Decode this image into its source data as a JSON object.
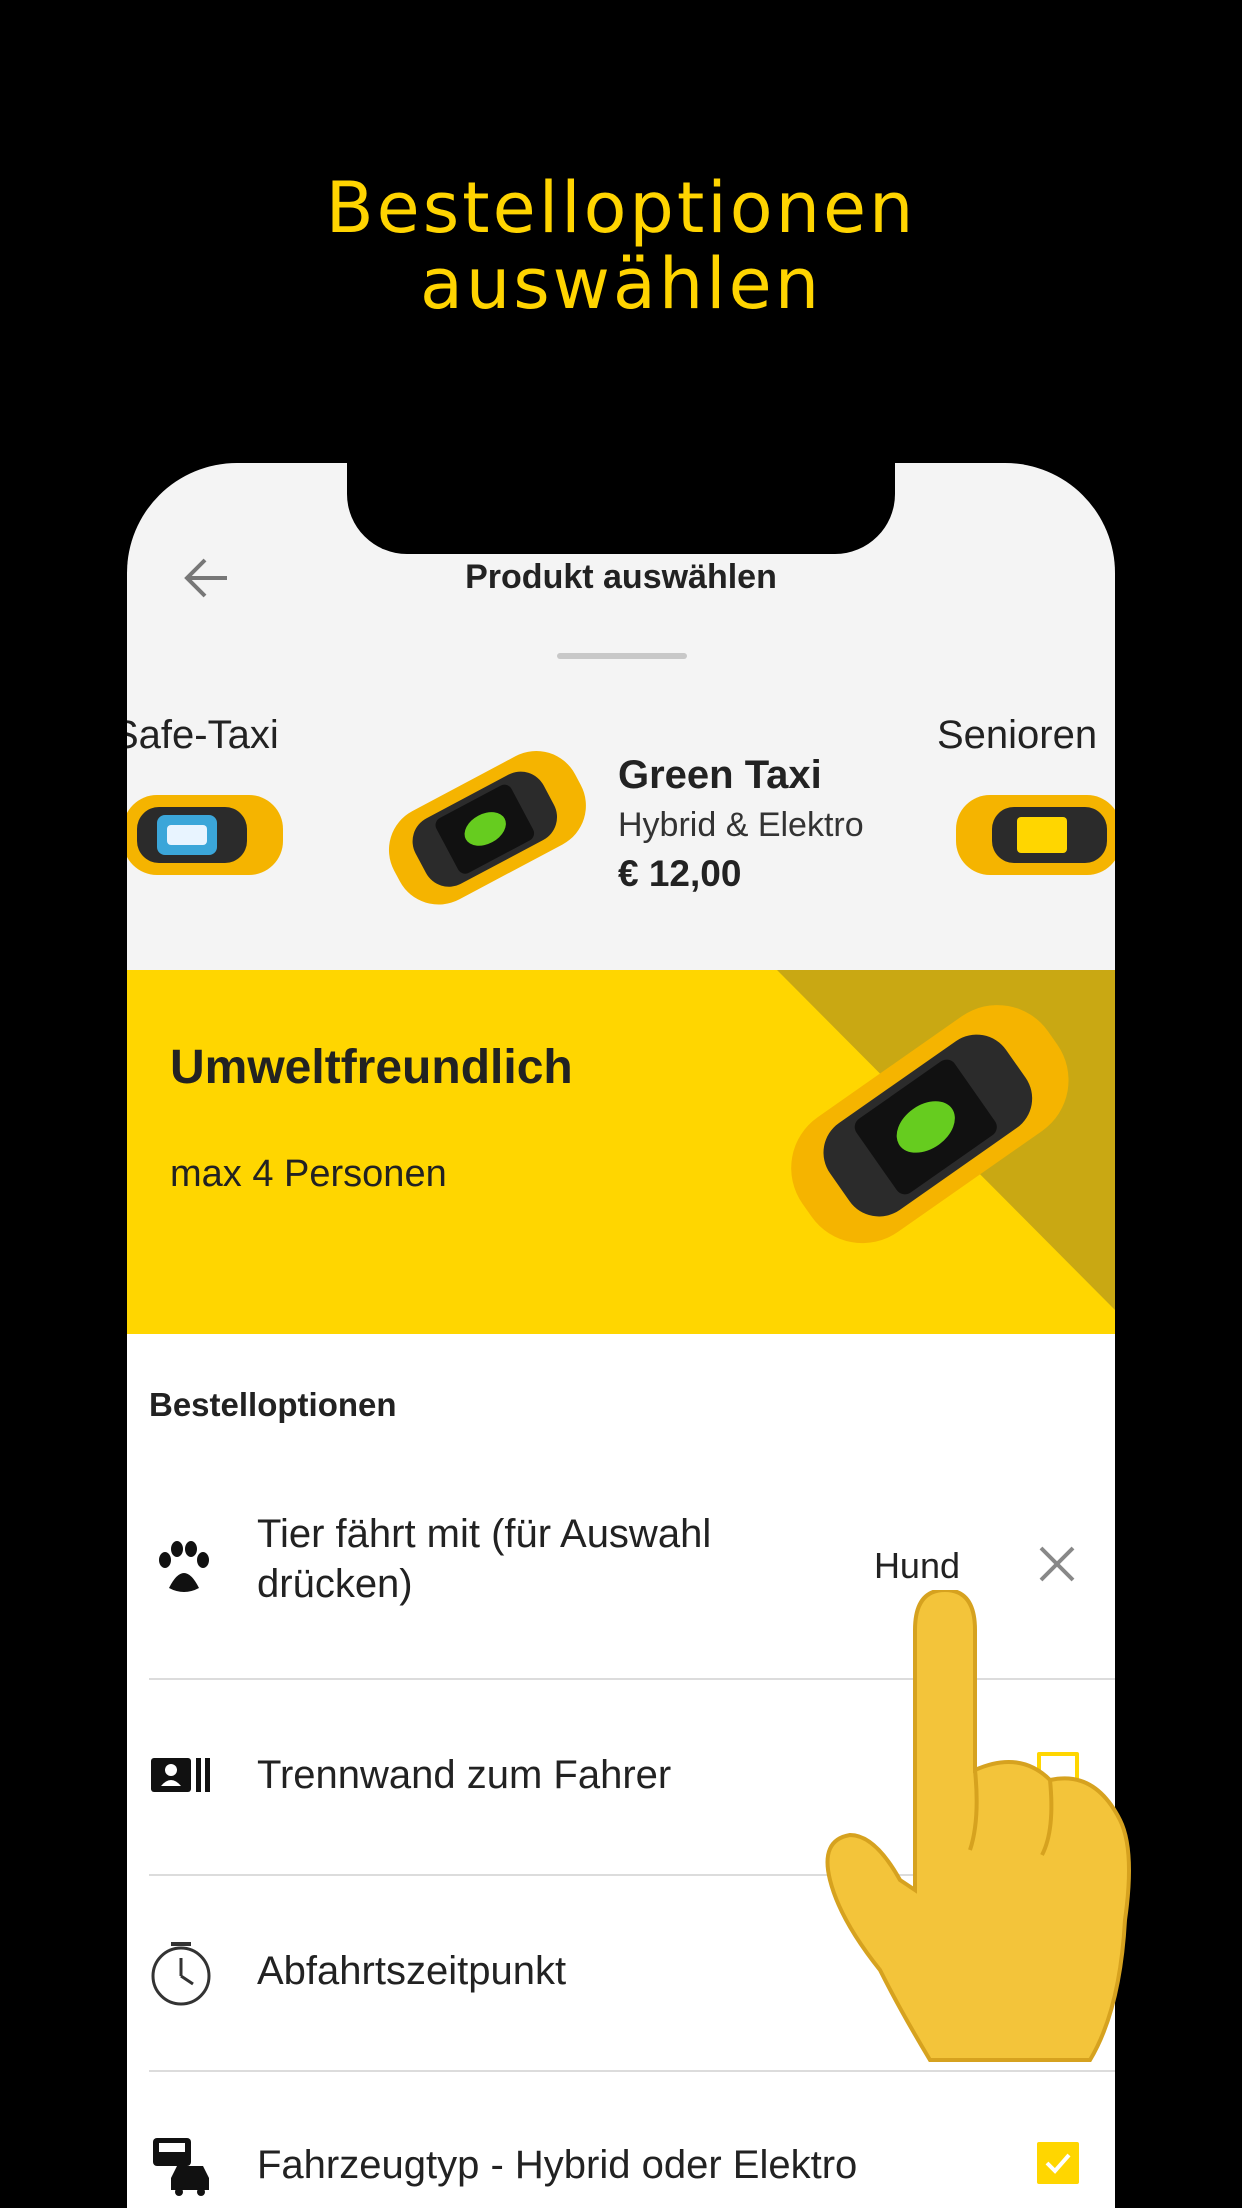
{
  "headline": {
    "line1": "Bestelloptionen",
    "line2": "auswählen"
  },
  "topbar": {
    "title": "Produkt auswählen",
    "back_icon": "arrow-left-icon"
  },
  "carousel": {
    "left_label": "Safe-Taxi",
    "right_label": "Senioren",
    "selected": {
      "name": "Green Taxi",
      "subtitle": "Hybrid & Elektro",
      "price": "€ 12,00"
    }
  },
  "banner": {
    "title": "Umweltfreundlich",
    "subtitle": "max 4 Personen"
  },
  "options": {
    "title": "Bestelloptionen",
    "items": [
      {
        "icon": "paw-icon",
        "label_line1": "Tier fährt mit (für Auswahl",
        "label_line2": "drücken)",
        "value": "Hund",
        "control": "clear"
      },
      {
        "icon": "partition-icon",
        "label": "Trennwand zum Fahrer",
        "control": "checkbox",
        "checked": false
      },
      {
        "icon": "clock-icon",
        "label": "Abfahrtszeitpunkt",
        "control": "none"
      },
      {
        "icon": "vehicle-type-icon",
        "label": "Fahrzeugtyp - Hybrid oder Elektro",
        "control": "checkbox",
        "checked": true
      }
    ]
  },
  "colors": {
    "accent": "#ffd600",
    "headline": "#ffd400",
    "background": "#000000"
  }
}
